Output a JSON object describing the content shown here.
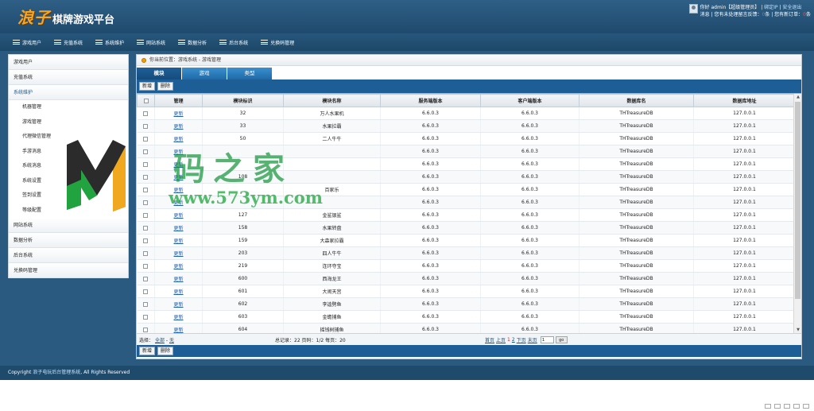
{
  "header": {
    "brand": "浪子",
    "subtitle": "棋牌游戏平台",
    "greeting": "你好 admin【超级管理员】",
    "links": [
      "绑定IP",
      "安全退出"
    ],
    "line2_prefix": "消息",
    "line2_text1": "您有未处理留言反馈：",
    "line2_count1": "0",
    "line2_unit1": "条",
    "line2_text2": "您有新订单：",
    "line2_count2": "0",
    "line2_unit2": "条"
  },
  "nav": [
    "游戏用户",
    "充值系统",
    "系统维护",
    "网站系统",
    "数据分析",
    "后台系统",
    "兑换码管理"
  ],
  "sidebar": {
    "top": [
      "游戏用户",
      "充值系统",
      "系统维护"
    ],
    "sub": [
      "机器管理",
      "游戏管理",
      "代理微信管理",
      "手游消息",
      "系统消息",
      "系统设置",
      "签到设置",
      "等级配置"
    ],
    "bottom": [
      "网站系统",
      "数据分析",
      "后台系统",
      "兑换码管理"
    ]
  },
  "breadcrumb": "你当前位置：游戏系统 - 游戏管理",
  "tabs": [
    "模块",
    "游戏",
    "类型"
  ],
  "toolbar": {
    "add": "新增",
    "delete": "删除"
  },
  "table": {
    "headers": [
      "管理",
      "模块标识",
      "模块名称",
      "服务端版本",
      "客户端版本",
      "数据库名",
      "数据库地址"
    ],
    "rows": [
      [
        "更新",
        "32",
        "万人水果机",
        "6.6.0.3",
        "6.6.0.3",
        "THTreasureDB",
        "127.0.0.1"
      ],
      [
        "更新",
        "33",
        "水果拉霸",
        "6.6.0.3",
        "6.6.0.3",
        "THTreasureDB",
        "127.0.0.1"
      ],
      [
        "更新",
        "50",
        "二人牛牛",
        "6.6.0.3",
        "6.6.0.3",
        "THTreasureDB",
        "127.0.0.1"
      ],
      [
        "更新",
        "",
        "",
        "6.6.0.3",
        "6.6.0.3",
        "THTreasureDB",
        "127.0.0.1"
      ],
      [
        "更新",
        "",
        "",
        "6.6.0.3",
        "6.6.0.3",
        "THTreasureDB",
        "127.0.0.1"
      ],
      [
        "更新",
        "108",
        "",
        "6.6.0.3",
        "6.6.0.3",
        "THTreasureDB",
        "127.0.0.1"
      ],
      [
        "更新",
        "",
        "百家乐",
        "6.6.0.3",
        "6.6.0.3",
        "THTreasureDB",
        "127.0.0.1"
      ],
      [
        "更新",
        "",
        "",
        "6.6.0.3",
        "6.6.0.3",
        "THTreasureDB",
        "127.0.0.1"
      ],
      [
        "更新",
        "127",
        "金鲨银鲨",
        "6.6.0.3",
        "6.6.0.3",
        "THTreasureDB",
        "127.0.0.1"
      ],
      [
        "更新",
        "158",
        "水果转盘",
        "6.6.0.3",
        "6.6.0.3",
        "THTreasureDB",
        "127.0.0.1"
      ],
      [
        "更新",
        "159",
        "大森家拉霸",
        "6.6.0.3",
        "6.6.0.3",
        "THTreasureDB",
        "127.0.0.1"
      ],
      [
        "更新",
        "203",
        "四人牛牛",
        "6.6.0.3",
        "6.6.0.3",
        "THTreasureDB",
        "127.0.0.1"
      ],
      [
        "更新",
        "219",
        "连环夺宝",
        "6.6.0.3",
        "6.6.0.3",
        "THTreasureDB",
        "127.0.0.1"
      ],
      [
        "更新",
        "600",
        "西海龙王",
        "6.6.0.3",
        "6.6.0.3",
        "THTreasureDB",
        "127.0.0.1"
      ],
      [
        "更新",
        "601",
        "大闹天宫",
        "6.6.0.3",
        "6.6.0.3",
        "THTreasureDB",
        "127.0.0.1"
      ],
      [
        "更新",
        "602",
        "李逵劈鱼",
        "6.6.0.3",
        "6.6.0.3",
        "THTreasureDB",
        "127.0.0.1"
      ],
      [
        "更新",
        "603",
        "金蟾捕鱼",
        "6.6.0.3",
        "6.6.0.3",
        "THTreasureDB",
        "127.0.0.1"
      ],
      [
        "更新",
        "604",
        "摇钱树捕鱼",
        "6.6.0.3",
        "6.6.0.3",
        "THTreasureDB",
        "127.0.0.1"
      ]
    ]
  },
  "pager": {
    "select_label": "选择：",
    "select_all": "全部",
    "select_none": "无",
    "summary": "总记录：22    页码：1/2    每页：20",
    "first": "首页",
    "prev": "上页",
    "page1": "1",
    "page2": "2",
    "next": "下页",
    "last": "末页",
    "input_value": "1",
    "go": "go"
  },
  "footer": {
    "prefix": "Copyright",
    "link": "浪子电玩后台管理系统",
    "suffix": ", All Rights Reserved"
  },
  "watermark": {
    "text": "码之家",
    "url": "www.573ym.com"
  },
  "colors": {
    "header_bg": "#2f5f86",
    "toolbar_bg": "#1d5e96",
    "tab_bg": "#2a7fc0",
    "brand": "#f6a623",
    "link": "#1a5fb4"
  }
}
